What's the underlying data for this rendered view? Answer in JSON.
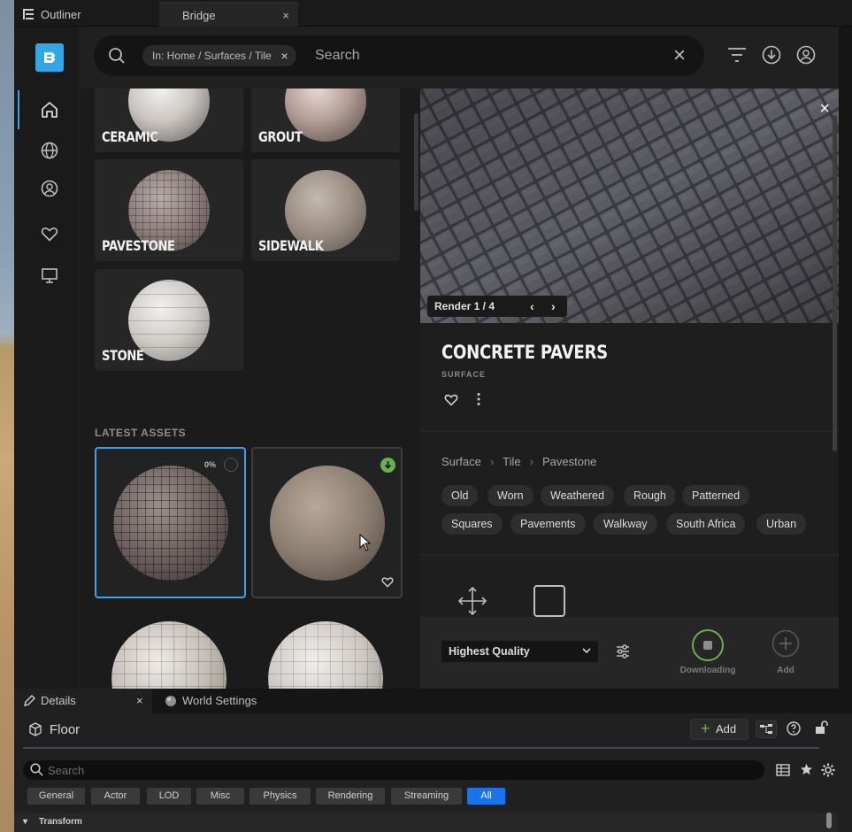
{
  "tabs": {
    "outliner": "Outliner",
    "bridge": "Bridge",
    "close": "×"
  },
  "search": {
    "scope_chip": "In: Home / Surfaces / Tile",
    "placeholder": "Search",
    "clear": "×"
  },
  "categories": [
    {
      "label": "CERAMIC"
    },
    {
      "label": "GROUT"
    },
    {
      "label": "PAVESTONE"
    },
    {
      "label": "SIDEWALK"
    },
    {
      "label": "STONE"
    }
  ],
  "latest_assets": {
    "heading": "LATEST ASSETS",
    "download_percent": "0%"
  },
  "detail": {
    "render_label": "Render 1 / 4",
    "title": "CONCRETE PAVERS",
    "type": "SURFACE",
    "close": "×",
    "breadcrumb": [
      "Surface",
      "Tile",
      "Pavestone"
    ],
    "tags": [
      "Old",
      "Worn",
      "Weathered",
      "Rough",
      "Patterned",
      "Squares",
      "Pavements",
      "Walkway",
      "South Africa",
      "Urban"
    ],
    "quality": "Highest Quality",
    "downloading_label": "Downloading",
    "add_label": "Add"
  },
  "details_panel": {
    "tab_details": "Details",
    "tab_world": "World Settings",
    "close": "×",
    "object_name": "Floor",
    "add_button": "Add",
    "search_placeholder": "Search",
    "filters": [
      "General",
      "Actor",
      "LOD",
      "Misc",
      "Physics",
      "Rendering",
      "Streaming",
      "All"
    ],
    "active_filter": "All",
    "section": "Transform"
  },
  "colors": {
    "accent": "#33a7e6",
    "selection": "#3fa0ea",
    "download_green": "#6ab04c",
    "active_filter": "#1a73e8"
  }
}
